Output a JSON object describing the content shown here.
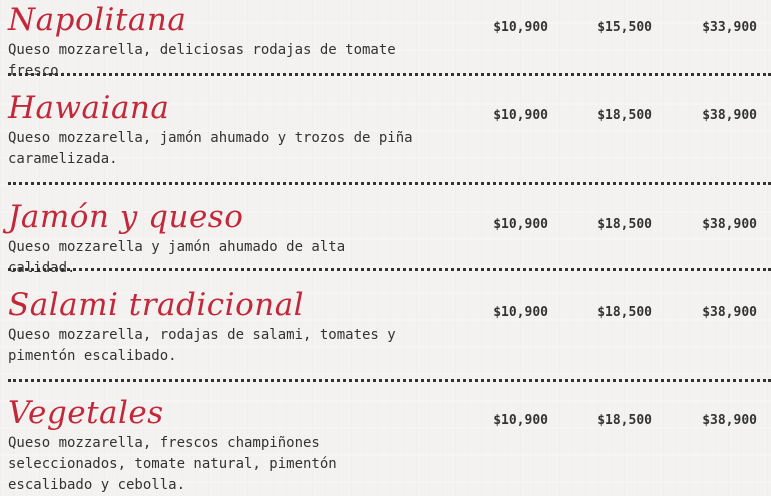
{
  "menu": {
    "items": [
      {
        "name": "Napolitana",
        "description": "Queso mozzarella, deliciosas rodajas de tomate fresco.",
        "prices": [
          "$10,900",
          "$15,500",
          "$33,900"
        ]
      },
      {
        "name": "Hawaiana",
        "description": "Queso mozzarella, jamón ahumado y trozos de piña caramelizada.",
        "prices": [
          "$10,900",
          "$18,500",
          "$38,900"
        ]
      },
      {
        "name": "Jamón y queso",
        "description": "Queso mozzarella y jamón ahumado de alta calidad.",
        "prices": [
          "$10,900",
          "$18,500",
          "$38,900"
        ]
      },
      {
        "name": "Salami tradicional",
        "description": "Queso mozzarella, rodajas de salami, tomates y pimentón escalibado.",
        "prices": [
          "$10,900",
          "$18,500",
          "$38,900"
        ]
      },
      {
        "name": "Vegetales",
        "description": "Queso mozzarella, frescos champiñones seleccionados, tomate natural, pimentón escalibado y cebolla.",
        "prices": [
          "$10,900",
          "$18,500",
          "$38,900"
        ]
      }
    ]
  },
  "colors": {
    "item_name": "#c3283a",
    "text": "#333333",
    "background": "#f3f2f0"
  }
}
